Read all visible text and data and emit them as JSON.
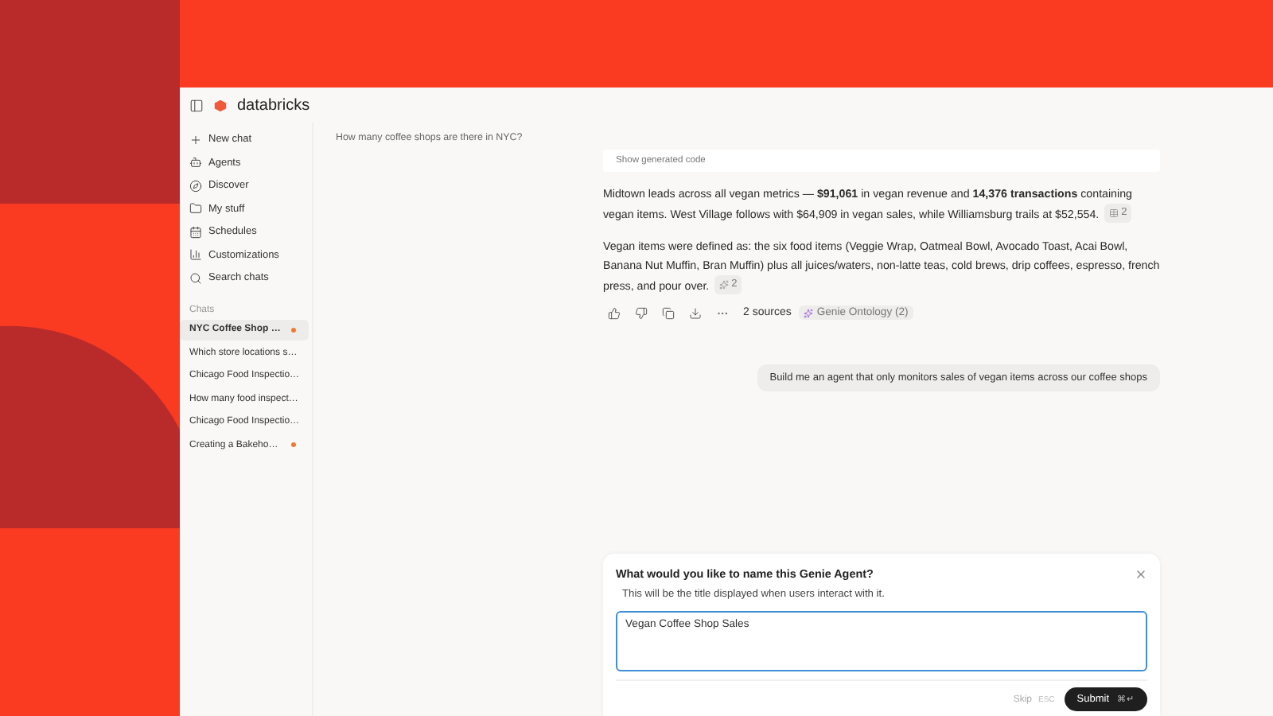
{
  "brand": "databricks",
  "nav": [
    {
      "kind": "plus",
      "label": "New chat"
    },
    {
      "kind": "agents",
      "label": "Agents"
    },
    {
      "kind": "compass",
      "label": "Discover"
    },
    {
      "kind": "folder",
      "label": "My stuff"
    },
    {
      "kind": "calendar",
      "label": "Schedules"
    },
    {
      "kind": "chart",
      "label": "Customizations"
    },
    {
      "kind": "search",
      "label": "Search chats"
    }
  ],
  "chats_heading": "Chats",
  "chats": [
    {
      "label": "NYC Coffee Shop …",
      "selected": true,
      "unread": true
    },
    {
      "label": "Which store locations s…",
      "selected": false,
      "unread": false
    },
    {
      "label": "Chicago Food Inspectio…",
      "selected": false,
      "unread": false
    },
    {
      "label": "How many food inspect…",
      "selected": false,
      "unread": false
    },
    {
      "label": "Chicago Food Inspectio…",
      "selected": false,
      "unread": false
    },
    {
      "label": "Creating a Bakeho…",
      "selected": false,
      "unread": true
    }
  ],
  "question": "How many coffee shops are there in NYC?",
  "answer": {
    "code_toggle": "Show generated code",
    "paragraphs": [
      {
        "text": "Midtown leads across all vegan metrics — **$91,061** in vegan revenue and **14,376 transactions** containing vegan items. West Village follows with $64,909 in vegan sales, while Williamsburg trails at $52,554.",
        "citation": {
          "kind": "table",
          "count": "2"
        }
      },
      {
        "text": "Vegan items were defined as: the six food items (Veggie Wrap, Oatmeal Bowl, Avocado Toast, Acai Bowl, Banana Nut Muffin, Bran Muffin) plus all juices/waters, non-latte teas, cold brews, drip coffees, espresso, french press, and pour over.",
        "citation": {
          "kind": "genie",
          "count": "2"
        }
      }
    ],
    "actions": [
      {
        "kind": "thumbs-up"
      },
      {
        "kind": "thumbs-down"
      },
      {
        "kind": "copy"
      },
      {
        "kind": "download"
      },
      {
        "kind": "more"
      }
    ],
    "sources": "2 sources",
    "source_chip": "Genie Ontology (2)"
  },
  "user_message": "Build me an agent that only monitors sales of vegan items across our coffee shops",
  "dialog": {
    "title": "What would you like to name this Genie Agent?",
    "subtitle": "This will be the title displayed when users interact with it.",
    "value": "Vegan Coffee Shop Sales",
    "skip": "Skip",
    "skip_key": "ESC",
    "submit": "Submit",
    "submit_key": "⌘↵"
  }
}
